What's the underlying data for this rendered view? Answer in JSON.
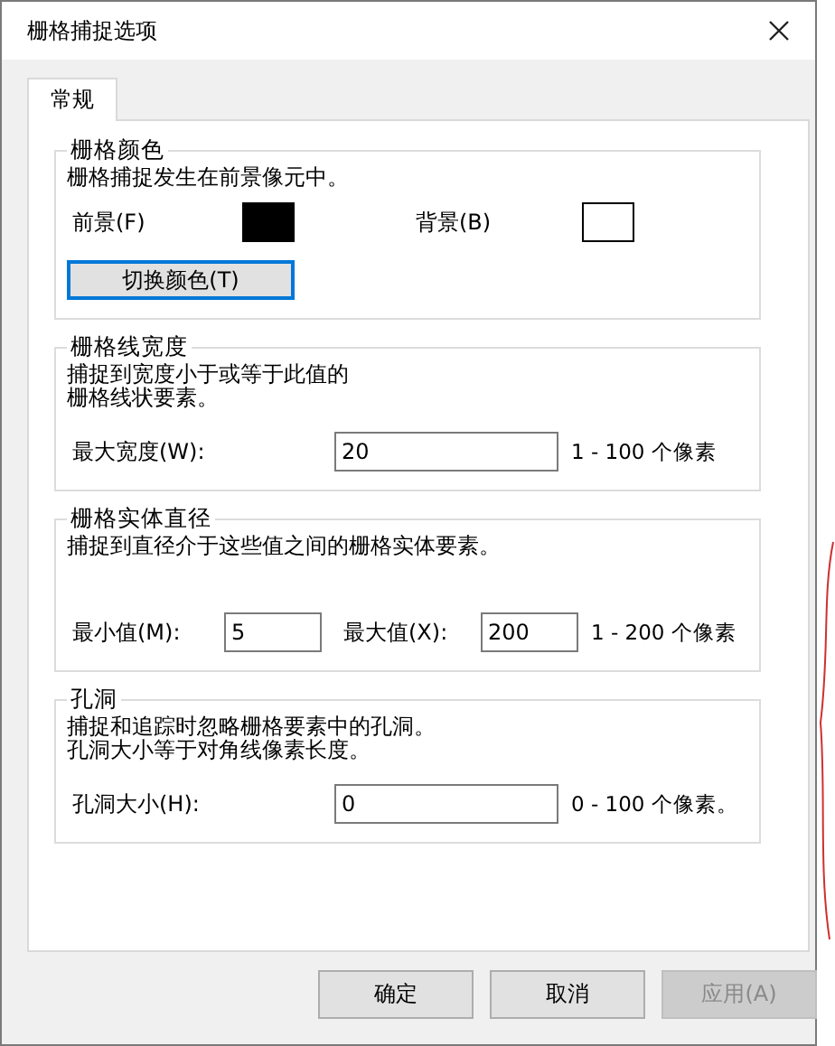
{
  "window": {
    "title": "栅格捕捉选项"
  },
  "tabs": [
    {
      "label": "常规",
      "selected": true
    }
  ],
  "groups": [
    {
      "kind": "color",
      "title": "栅格颜色",
      "description": [
        "栅格捕捉发生在前景像元中。"
      ],
      "foreground": {
        "label": "前景(F)",
        "color": "#000000"
      },
      "background": {
        "label": "背景(B)",
        "color": "#ffffff"
      },
      "button": {
        "label": "切换颜色(T)",
        "focused": true
      }
    },
    {
      "kind": "single",
      "title": "栅格线宽度",
      "description": [
        "捕捉到宽度小于或等于此值的",
        "栅格线状要素。"
      ],
      "field": {
        "label": "最大宽度(W):",
        "value": "20"
      },
      "range": "1 - 100 个像素"
    },
    {
      "kind": "range",
      "title": "栅格实体直径",
      "description": [
        "捕捉到直径介于这些值之间的栅格实体要素。"
      ],
      "min": {
        "label": "最小值(M):",
        "value": "5"
      },
      "max": {
        "label": "最大值(X):",
        "value": "200"
      },
      "range": "1 - 200 个像素"
    },
    {
      "kind": "single",
      "title": "孔洞",
      "description": [
        "捕捉和追踪时忽略栅格要素中的孔洞。",
        "孔洞大小等于对角线像素长度。"
      ],
      "field": {
        "label": "孔洞大小(H):",
        "value": "0"
      },
      "range": "0 - 100 个像素。"
    }
  ],
  "buttons": [
    {
      "label": "确定",
      "disabled": false
    },
    {
      "label": "取消",
      "disabled": false
    },
    {
      "label": "应用(A)",
      "disabled": true
    }
  ]
}
